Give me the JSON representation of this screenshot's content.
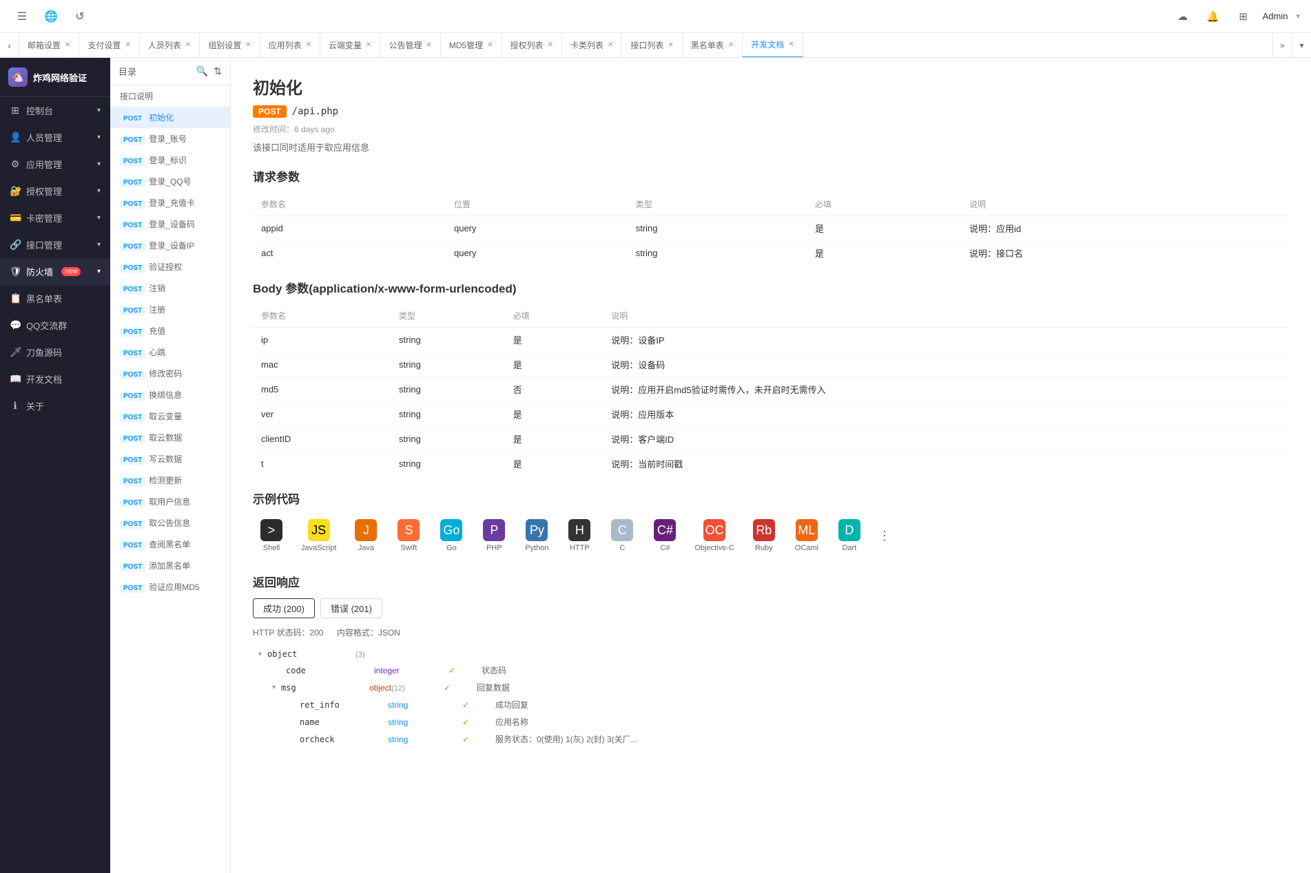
{
  "topbar": {
    "icons": [
      "☰",
      "🌐",
      "↺"
    ],
    "right_icons": [
      "☁",
      "🔔",
      "⊞"
    ],
    "admin_label": "Admin",
    "admin_arrow": "▾"
  },
  "tabs": [
    {
      "id": "tab-mail",
      "label": "邮箱设置",
      "active": false
    },
    {
      "id": "tab-payment",
      "label": "支付设置",
      "active": false
    },
    {
      "id": "tab-users",
      "label": "人员列表",
      "active": false
    },
    {
      "id": "tab-group",
      "label": "组别设置",
      "active": false
    },
    {
      "id": "tab-apps",
      "label": "应用列表",
      "active": false
    },
    {
      "id": "tab-cloud",
      "label": "云端变量",
      "active": false
    },
    {
      "id": "tab-notice",
      "label": "公告管理",
      "active": false
    },
    {
      "id": "tab-md5",
      "label": "MD5管理",
      "active": false
    },
    {
      "id": "tab-auth",
      "label": "授权列表",
      "active": false
    },
    {
      "id": "tab-cards",
      "label": "卡类列表",
      "active": false
    },
    {
      "id": "tab-api",
      "label": "接口列表",
      "active": false
    },
    {
      "id": "tab-blacklist",
      "label": "黑名单表",
      "active": false
    },
    {
      "id": "tab-docs",
      "label": "开发文档",
      "active": true
    }
  ],
  "sidebar": {
    "logo_text": "炸鸡网络验证",
    "logo_emoji": "🐔",
    "menu_items": [
      {
        "id": "dashboard",
        "icon": "⊞",
        "label": "控制台",
        "has_arrow": true
      },
      {
        "id": "users",
        "icon": "👤",
        "label": "人员管理",
        "has_arrow": true
      },
      {
        "id": "apps",
        "icon": "⚙",
        "label": "应用管理",
        "has_arrow": true
      },
      {
        "id": "auth",
        "icon": "🔐",
        "label": "授权管理",
        "has_arrow": true
      },
      {
        "id": "cards",
        "icon": "💳",
        "label": "卡密管理",
        "has_arrow": true
      },
      {
        "id": "api-mgr",
        "icon": "🔗",
        "label": "接口管理",
        "has_arrow": true
      },
      {
        "id": "firewall",
        "icon": "🛡",
        "label": "防火墙",
        "badge": "new",
        "has_arrow": true,
        "active": true
      },
      {
        "id": "blacklist",
        "icon": "📋",
        "label": "黑名单表",
        "has_arrow": false
      },
      {
        "id": "qq",
        "icon": "💬",
        "label": "QQ交流群",
        "has_arrow": false
      },
      {
        "id": "knife",
        "icon": "🗡",
        "label": "刀鱼源码",
        "has_arrow": false
      },
      {
        "id": "devdocs",
        "icon": "📖",
        "label": "开发文档",
        "has_arrow": false
      },
      {
        "id": "about",
        "icon": "ℹ",
        "label": "关于",
        "has_arrow": false
      }
    ]
  },
  "doc_panel": {
    "title": "目录",
    "items": [
      {
        "label": "接口说明",
        "type": "header"
      },
      {
        "label": "初始化",
        "method": "POST",
        "active": true
      },
      {
        "label": "登录_账号",
        "method": "POST"
      },
      {
        "label": "登录_标识",
        "method": "POST"
      },
      {
        "label": "登录_QQ号",
        "method": "POST"
      },
      {
        "label": "登录_充值卡",
        "method": "POST"
      },
      {
        "label": "登录_设备码",
        "method": "POST"
      },
      {
        "label": "登录_设备IP",
        "method": "POST"
      },
      {
        "label": "验证授权",
        "method": "POST"
      },
      {
        "label": "注销",
        "method": "POST"
      },
      {
        "label": "注册",
        "method": "POST"
      },
      {
        "label": "充值",
        "method": "POST"
      },
      {
        "label": "心跳",
        "method": "POST"
      },
      {
        "label": "修改密码",
        "method": "POST"
      },
      {
        "label": "换绑信息",
        "method": "POST"
      },
      {
        "label": "取云变量",
        "method": "POST"
      },
      {
        "label": "取云数据",
        "method": "POST"
      },
      {
        "label": "写云数据",
        "method": "POST"
      },
      {
        "label": "检测更新",
        "method": "POST"
      },
      {
        "label": "取用户信息",
        "method": "POST"
      },
      {
        "label": "取公告信息",
        "method": "POST"
      },
      {
        "label": "查阅黑名单",
        "method": "POST"
      },
      {
        "label": "添加黑名单",
        "method": "POST"
      },
      {
        "label": "验证应用MD5",
        "method": "POST"
      }
    ]
  },
  "api": {
    "title": "初始化",
    "method": "POST",
    "path": "/api.php",
    "modified": "修改时间：6 days ago",
    "description": "该接口同时适用于取应用信息",
    "request_params_title": "请求参数",
    "request_params_headers": [
      "参数名",
      "位置",
      "类型",
      "必填",
      "说明"
    ],
    "request_params": [
      {
        "name": "appid",
        "location": "query",
        "type": "string",
        "required": "是",
        "desc": "说明：应用id"
      },
      {
        "name": "act",
        "location": "query",
        "type": "string",
        "required": "是",
        "desc": "说明：接口名"
      }
    ],
    "body_title": "Body 参数(application/x-www-form-urlencoded)",
    "body_headers": [
      "参数名",
      "类型",
      "必填",
      "说明"
    ],
    "body_params": [
      {
        "name": "ip",
        "type": "string",
        "required": "是",
        "desc": "说明：设备IP"
      },
      {
        "name": "mac",
        "type": "string",
        "required": "是",
        "desc": "说明：设备码"
      },
      {
        "name": "md5",
        "type": "string",
        "required": "否",
        "desc": "说明：应用开启md5验证时需传入，未开启时无需传入"
      },
      {
        "name": "ver",
        "type": "string",
        "required": "是",
        "desc": "说明：应用版本"
      },
      {
        "name": "clientID",
        "type": "string",
        "required": "是",
        "desc": "说明：客户端ID"
      },
      {
        "name": "t",
        "type": "string",
        "required": "是",
        "desc": "说明：当前时间戳"
      }
    ],
    "code_examples_title": "示例代码",
    "code_tabs": [
      {
        "id": "shell",
        "label": "Shell",
        "icon_class": "icon-shell",
        "icon_text": ">"
      },
      {
        "id": "javascript",
        "label": "JavaScript",
        "icon_class": "icon-js",
        "icon_text": "JS"
      },
      {
        "id": "java",
        "label": "Java",
        "icon_class": "icon-java",
        "icon_text": "J"
      },
      {
        "id": "swift",
        "label": "Swift",
        "icon_class": "icon-swift",
        "icon_text": "S"
      },
      {
        "id": "go",
        "label": "Go",
        "icon_class": "icon-go",
        "icon_text": "Go"
      },
      {
        "id": "php",
        "label": "PHP",
        "icon_class": "icon-php",
        "icon_text": "P"
      },
      {
        "id": "python",
        "label": "Python",
        "icon_class": "icon-python",
        "icon_text": "Py"
      },
      {
        "id": "http",
        "label": "HTTP",
        "icon_class": "icon-http",
        "icon_text": "H"
      },
      {
        "id": "c",
        "label": "C",
        "icon_class": "icon-c",
        "icon_text": "C"
      },
      {
        "id": "csharp",
        "label": "C#",
        "icon_class": "icon-csharp",
        "icon_text": "C#"
      },
      {
        "id": "objc",
        "label": "Objective-C",
        "icon_class": "icon-objc",
        "icon_text": "OC"
      },
      {
        "id": "ruby",
        "label": "Ruby",
        "icon_class": "icon-ruby",
        "icon_text": "Rb"
      },
      {
        "id": "ocaml",
        "label": "OCaml",
        "icon_class": "icon-ocaml",
        "icon_text": "ML"
      },
      {
        "id": "dart",
        "label": "Dart",
        "icon_class": "icon-dart",
        "icon_text": "D"
      }
    ],
    "response_title": "返回响应",
    "response_tabs": [
      {
        "label": "成功 (200)",
        "active": true
      },
      {
        "label": "错误 (201)",
        "active": false
      }
    ],
    "response_http_status": "HTTP 状态码：200",
    "response_content_type": "内容格式：JSON",
    "response_tree": [
      {
        "indent": 0,
        "toggle": "▾",
        "name": "object",
        "count": "(3)",
        "type": "",
        "required": "",
        "desc": ""
      },
      {
        "indent": 1,
        "name": "code",
        "type": "integer",
        "type_class": "type-integer",
        "required": "✓",
        "desc": "状态码"
      },
      {
        "indent": 1,
        "toggle": "▾",
        "name": "msg",
        "type": "object",
        "count": "(12)",
        "type_class": "type-object",
        "required": "✓",
        "desc": "回复数据"
      },
      {
        "indent": 2,
        "name": "ret_info",
        "type": "string",
        "type_class": "type-string",
        "required": "✓",
        "desc": "成功回复"
      },
      {
        "indent": 2,
        "name": "name",
        "type": "string",
        "type_class": "type-string",
        "required": "✓",
        "desc": "应用名称"
      },
      {
        "indent": 2,
        "name": "orcheck",
        "type": "string",
        "type_class": "type-string",
        "required": "✓",
        "desc": "服务状态：0(使用) 1(灰) 2(封) 3(关厂..."
      }
    ]
  }
}
